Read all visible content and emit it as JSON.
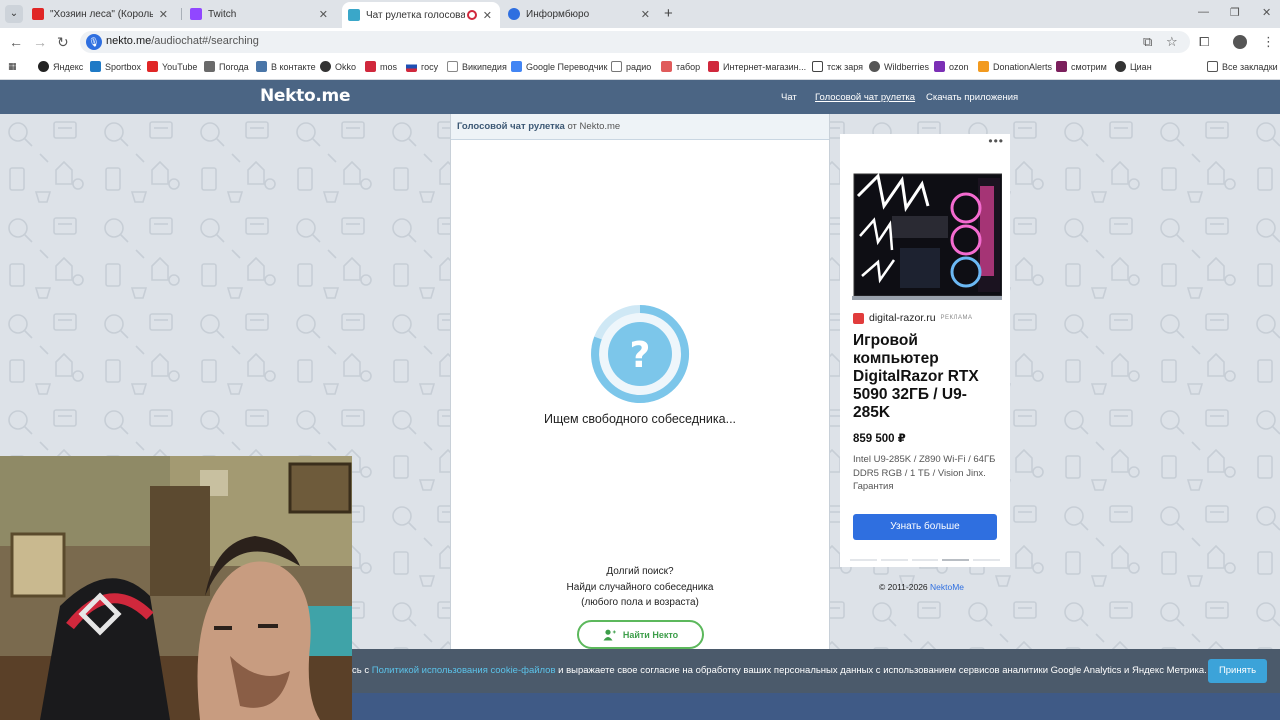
{
  "browser": {
    "tabs": [
      {
        "title": "\"Хозяин леса\" (Король и Шут)",
        "favicon": "youtube-icon",
        "color": "#e02626",
        "active": false
      },
      {
        "title": "Twitch",
        "favicon": "twitch-icon",
        "color": "#9147ff",
        "active": false
      },
      {
        "title": "Чат рулетка голосовая — ",
        "favicon": "nekto-icon",
        "color": "#3aa7c9",
        "active": true
      },
      {
        "title": "Информбюро",
        "favicon": "globe-icon",
        "color": "#2f6fe0",
        "active": false
      }
    ],
    "url_host": "nekto.me",
    "url_path": "/audiochat#/searching",
    "bookmarks": [
      {
        "label": "Яндекс",
        "color": "#222222"
      },
      {
        "label": "Sportbox",
        "color": "#1f7ac6"
      },
      {
        "label": "YouTube",
        "color": "#e02626"
      },
      {
        "label": "Погода",
        "color": "#6a6a6a"
      },
      {
        "label": "В контакте",
        "color": "#4a76a8"
      },
      {
        "label": "Okko",
        "color": "#333333"
      },
      {
        "label": "mos",
        "color": "#d0283c"
      },
      {
        "label": "госу",
        "color": "#1e4fb3"
      },
      {
        "label": "Википедия",
        "color": "#333333"
      },
      {
        "label": "Google Переводчик",
        "color": "#4285f4"
      },
      {
        "label": "радио",
        "color": "#777777"
      },
      {
        "label": "табор",
        "color": "#e05b5b"
      },
      {
        "label": "Интернет-магазин...",
        "color": "#d0283c"
      },
      {
        "label": "тсж заря",
        "color": "#444444"
      },
      {
        "label": "Wildberries",
        "color": "#555555"
      },
      {
        "label": "ozon",
        "color": "#7b2fb5"
      },
      {
        "label": "DonationAlerts",
        "color": "#f29a1f"
      },
      {
        "label": "смотрим",
        "color": "#7b1f5c"
      },
      {
        "label": "Циан",
        "color": "#333333"
      }
    ],
    "all_bookmarks": "Все закладки"
  },
  "site": {
    "logo": "Nekto.me",
    "nav": [
      "Чат",
      "Голосовой чат рулетка",
      "Скачать приложения"
    ]
  },
  "chat": {
    "header_bold": "Голосовой чат рулетка",
    "header_rest": " от Nekto.me",
    "spinner_glyph": "?",
    "status": "Ищем свободного собеседника...",
    "long_search_1": "Долгий поиск?",
    "long_search_2": "Найди случайного собеседника",
    "long_search_3": "(любого пола и возраста)",
    "find_button": "Найти Некто"
  },
  "ad": {
    "menu": "•••",
    "brand": "digital-razor.ru",
    "ad_label": "РЕКЛАМА",
    "title": "Игровой компьютер DigitalRazor RTX 5090 32ГБ / U9-285K",
    "price": "859 500 ₽",
    "description": "Intel U9-285K / Z890 Wi-Fi / 64ГБ DDR5 RGB / 1 ТБ / Vision Jinx. Гарантия",
    "button": "Узнать больше",
    "pager_active_index": 3
  },
  "footer": {
    "copyright": "© 2011-2026 ",
    "copyright_link": "NektoMe"
  },
  "cookie": {
    "text_before": "сь с ",
    "link": "Политикой использования cookie-файлов",
    "text_after": " и выражаете свое согласие на обработку ваших персональных данных с использованием сервисов аналитики Google Analytics и Яндекс Метрика.",
    "accept": "Принять"
  }
}
